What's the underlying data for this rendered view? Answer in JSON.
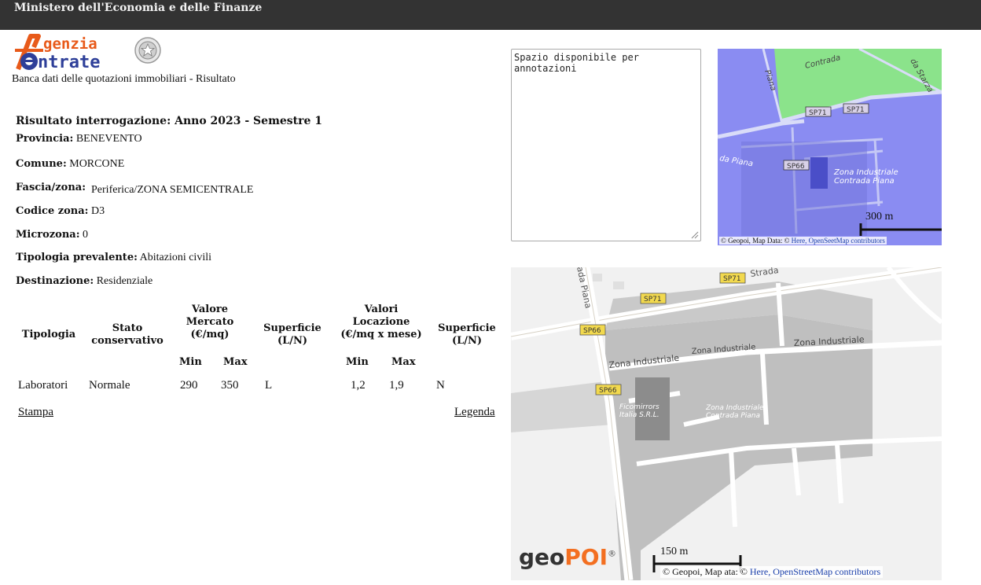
{
  "header": {
    "title": "Ministero dell'Economia e delle Finanze"
  },
  "logo": {
    "line1": "genzia",
    "line2": "ntrate"
  },
  "subtitle": "Banca dati delle quotazioni immobiliari - Risultato",
  "result": {
    "title": "Risultato interrogazione: Anno 2023 - Semestre 1",
    "fields": [
      {
        "label": "Provincia:",
        "value": "BENEVENTO"
      },
      {
        "label": "Comune:",
        "value": "MORCONE"
      },
      {
        "label": "Fascia/zona:",
        "value": "Periferica/ZONA SEMICENTRALE"
      },
      {
        "label": "Codice zona:",
        "value": "D3"
      },
      {
        "label": "Microzona:",
        "value": "0"
      },
      {
        "label": "Tipologia prevalente:",
        "value": "Abitazioni civili"
      },
      {
        "label": "Destinazione:",
        "value": "Residenziale"
      }
    ]
  },
  "table": {
    "headers": {
      "tipologia": "Tipologia",
      "stato": [
        "Stato",
        "conservativo"
      ],
      "valore": [
        "Valore",
        "Mercato",
        "(€/mq)"
      ],
      "superficie1": [
        "Superficie",
        "(L/N)"
      ],
      "valori": [
        "Valori",
        "Locazione",
        "(€/mq x mese)"
      ],
      "superficie2": [
        "Superficie",
        "(L/N)"
      ],
      "min": "Min",
      "max": "Max"
    },
    "rows": [
      {
        "tipologia": "Laboratori",
        "stato": "Normale",
        "min1": "290",
        "max1": "350",
        "sup1": "L",
        "min2": "1,2",
        "max2": "1,9",
        "sup2": "N"
      }
    ]
  },
  "links": {
    "print": "Stampa",
    "legend": "Legenda"
  },
  "notes": {
    "value": "Spazio disponibile per\nannotazioni"
  },
  "map_small": {
    "scale": "300 m",
    "attribution_prefix": "© Geopoi, Map Data: © ",
    "attribution_link": "Here, OpenS",
    "attribution_link2": "eetMap contributors",
    "labels": {
      "contrada": "Contrada",
      "piana_top": "Piana",
      "starza": "da Starza",
      "sp71a": "SP71",
      "sp71b": "SP71",
      "sp66": "SP66",
      "strada_piana": "da Piana",
      "zona": "Zona Industriale",
      "contrada_piana": "Contrada Piana"
    }
  },
  "map_big": {
    "scale": "150 m",
    "attribution_prefix": "© Geopoi, Map ",
    "attribution_mid": "ata: © ",
    "attribution_link": "Here, OpenStreetMap contributors",
    "brand": {
      "geo": "geo",
      "poi": "POI",
      "reg": "®"
    },
    "labels": {
      "strada_piana": "ada Piana",
      "sp71a": "SP71",
      "strada": "Strada",
      "sp71b": "SP71",
      "sp66a": "SP66",
      "sp66b": "SP66",
      "zona1": "Zona Industriale",
      "zona2": "Zona Industriale",
      "zona3": "Zona Industriale",
      "ficomirrors1": "Ficomirrors",
      "ficomirrors2": "Italia S.R.L.",
      "zona4": "Zona Industriale",
      "contrada_piana": "Contrada Piana"
    }
  }
}
